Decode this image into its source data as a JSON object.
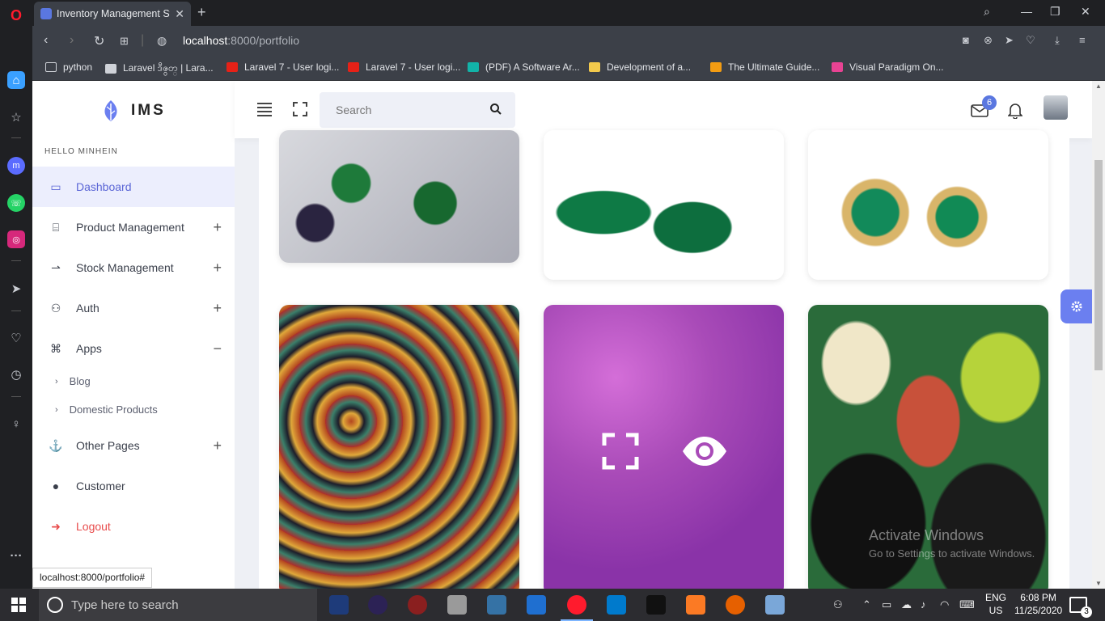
{
  "browser": {
    "tab_title": "Inventory Management Sys",
    "url_host": "localhost",
    "url_path": ":8000/portfolio",
    "status_url": "localhost:8000/portfolio#"
  },
  "bookmarks": [
    {
      "label": "python",
      "color": "#cfd2d8"
    },
    {
      "label": "Laravel ဒီဇွတ္ | Lara...",
      "color": "#cfd2d8"
    },
    {
      "label": "Laravel 7 - User logi...",
      "color": "#e62117"
    },
    {
      "label": "Laravel 7 - User logi...",
      "color": "#e62117"
    },
    {
      "label": "(PDF) A Software Ar...",
      "color": "#12b3a8"
    },
    {
      "label": "Development of a...",
      "color": "#f2c94c"
    },
    {
      "label": "The Ultimate Guide...",
      "color": "#f39c12"
    },
    {
      "label": "Visual Paradigm On...",
      "color": "#e84393"
    }
  ],
  "sidebar": {
    "brand": "IMS",
    "greeting": "HELLO MINHEIN",
    "items": [
      {
        "label": "Dashboard",
        "icon": "monitor-icon"
      },
      {
        "label": "Product Management",
        "icon": "gift-icon",
        "toggle": "+"
      },
      {
        "label": "Stock Management",
        "icon": "stock-icon",
        "toggle": "+"
      },
      {
        "label": "Auth",
        "icon": "user-icon",
        "toggle": "+"
      },
      {
        "label": "Apps",
        "icon": "command-icon",
        "toggle": "−"
      },
      {
        "label": "Other Pages",
        "icon": "anchor-icon",
        "toggle": "+"
      },
      {
        "label": "Customer",
        "icon": "user-circle-icon"
      },
      {
        "label": "Logout",
        "icon": "logout-icon"
      }
    ],
    "apps_sub": [
      "Blog",
      "Domestic Products"
    ]
  },
  "topbar": {
    "search_placeholder": "Search",
    "mail_badge": "6"
  },
  "watermark": {
    "line1": "Activate Windows",
    "line2": "Go to Settings to activate Windows."
  },
  "taskbar": {
    "search_placeholder": "Type here to search",
    "lang": "ENG",
    "region": "US",
    "time": "6:08 PM",
    "date": "11/25/2020",
    "notifications": "3"
  },
  "colors": {
    "accent": "#5a65d6",
    "logout": "#e84c4c",
    "fab": "#6b7ff0"
  }
}
